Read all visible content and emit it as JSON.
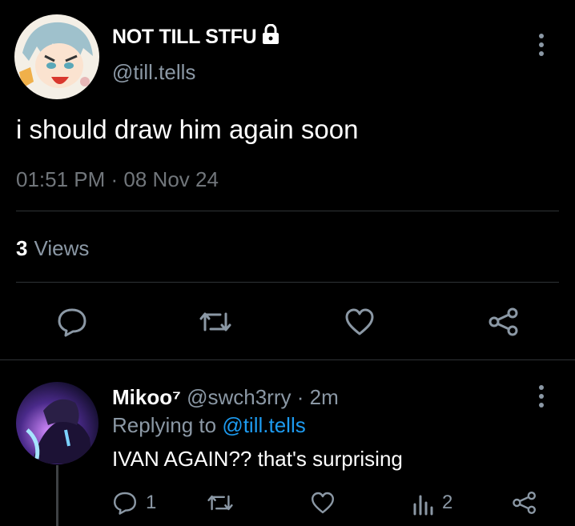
{
  "tweet": {
    "display_name": "NOT TILL STFU",
    "handle": "@till.tells",
    "text": "i should draw him again soon",
    "timestamp": "01:51 PM · 08 Nov 24",
    "views_count": "3",
    "views_label": "Views",
    "icons": [
      "lock-icon",
      "more-vertical-icon",
      "reply-icon",
      "retweet-icon",
      "like-icon",
      "share-icon"
    ]
  },
  "reply": {
    "display_name": "Mikoo⁷",
    "handle": "@swch3rry",
    "separator": "·",
    "time": "2m",
    "replying_prefix": "Replying to",
    "replying_handle": "@till.tells",
    "text": "IVAN AGAIN?? that's surprising",
    "reply_count": "1",
    "views_count": "2",
    "icons": [
      "reply-icon",
      "retweet-icon",
      "like-icon",
      "views-icon",
      "share-icon",
      "more-vertical-icon"
    ]
  },
  "colors": {
    "background": "#000000",
    "text_primary": "#ffffff",
    "text_secondary": "#8b98a5",
    "link": "#1d9bf0",
    "divider": "#2f3336"
  }
}
